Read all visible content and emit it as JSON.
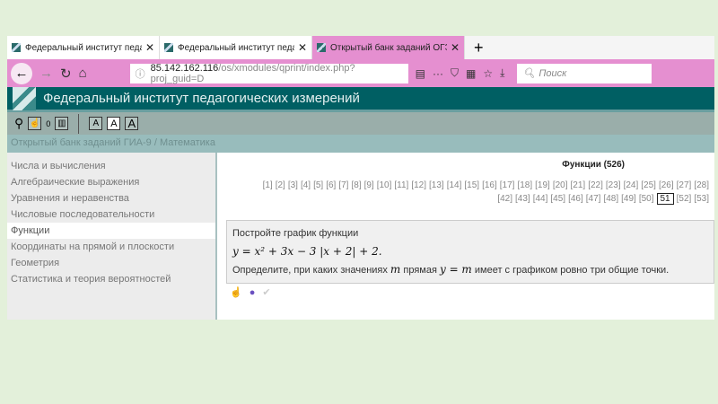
{
  "tabs": [
    {
      "label": "Федеральный институт педагогических"
    },
    {
      "label": "Федеральный институт педагогических"
    },
    {
      "label": "Открытый банк заданий ОГЭ"
    }
  ],
  "nav": {
    "url_host": "85.142.162.116",
    "url_path": "/os/xmodules/qprint/index.php?proj_guid=D",
    "search_placeholder": "Поиск"
  },
  "header": {
    "title": "Федеральный институт педагогических измерений"
  },
  "tools": {
    "counter": "0",
    "font_small": "A",
    "font_medium": "A",
    "font_large": "A"
  },
  "breadcrumb": "Открытый банк заданий ГИА-9 / Математика",
  "sidebar": {
    "items": [
      {
        "label": "Числа и вычисления"
      },
      {
        "label": "Алгебраические выражения"
      },
      {
        "label": "Уравнения и неравенства"
      },
      {
        "label": "Числовые последовательности"
      },
      {
        "label": "Функции"
      },
      {
        "label": "Координаты на прямой и плоскости"
      },
      {
        "label": "Геометрия"
      },
      {
        "label": "Статистика и теория вероятностей"
      }
    ],
    "selected": 4
  },
  "main": {
    "title": "Функции (526)",
    "pages_row1": [
      "[1]",
      "[2]",
      "[3]",
      "[4]",
      "[5]",
      "[6]",
      "[7]",
      "[8]",
      "[9]",
      "[10]",
      "[11]",
      "[12]",
      "[13]",
      "[14]",
      "[15]",
      "[16]",
      "[17]",
      "[18]",
      "[19]",
      "[20]",
      "[21]",
      "[22]",
      "[23]",
      "[24]",
      "[25]",
      "[26]",
      "[27]",
      "[28]"
    ],
    "pages_row2": [
      "[42]",
      "[43]",
      "[44]",
      "[45]",
      "[46]",
      "[47]",
      "[48]",
      "[49]",
      "[50]",
      "51",
      "[52]",
      "[53]"
    ],
    "current_page": "51",
    "task": {
      "line1": "Постройте график функции",
      "formula": "y = x² + 3x − 3 |x + 2| + 2.",
      "line3_a": "Определите, при каких значениях ",
      "m": "m",
      "line3_b": " прямая ",
      "ym": "y = m",
      "line3_c": " имеет с графиком ровно три общие точки."
    }
  }
}
